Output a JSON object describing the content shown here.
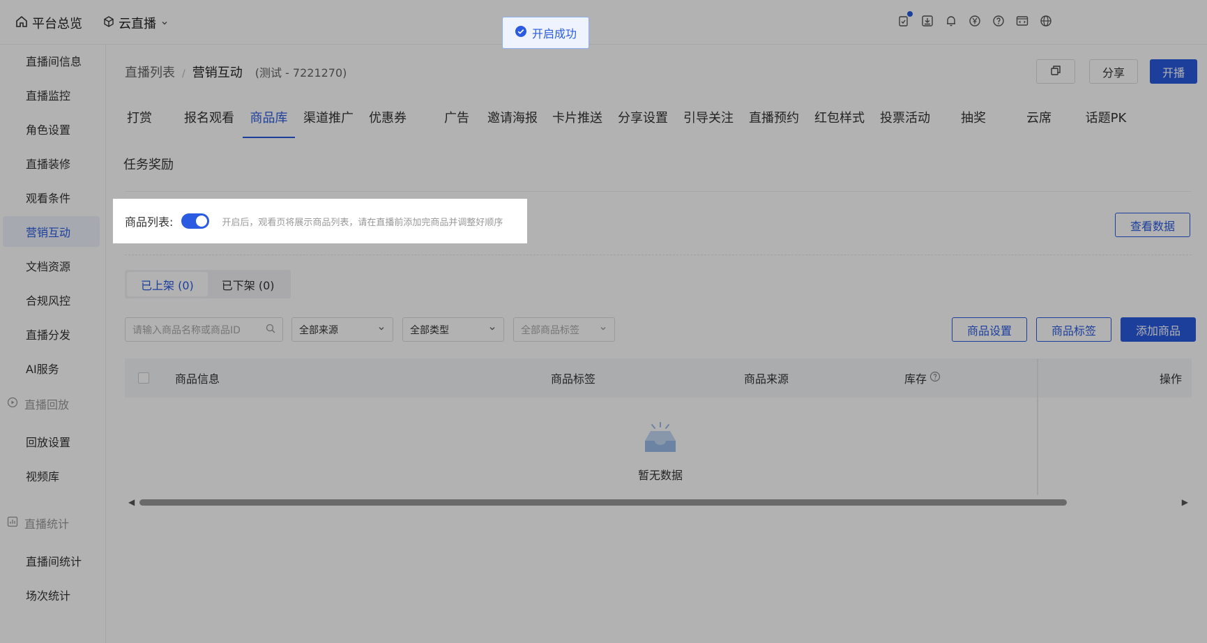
{
  "topbar": {
    "brand": "平台总览",
    "product": "云直播",
    "icons": [
      "task-icon",
      "download-icon",
      "bell-icon",
      "yuan-icon",
      "help-icon",
      "code-icon",
      "globe-icon"
    ]
  },
  "sidebar": {
    "items": [
      {
        "label": "直播间信息"
      },
      {
        "label": "直播监控"
      },
      {
        "label": "角色设置"
      },
      {
        "label": "直播装修"
      },
      {
        "label": "观看条件"
      },
      {
        "label": "营销互动"
      },
      {
        "label": "文档资源"
      },
      {
        "label": "合规风控"
      },
      {
        "label": "直播分发"
      },
      {
        "label": "AI服务"
      }
    ],
    "group_replay": "直播回放",
    "replay_items": [
      {
        "label": "回放设置"
      },
      {
        "label": "视频库"
      }
    ],
    "group_stats": "直播统计",
    "stats_items": [
      {
        "label": "直播间统计"
      },
      {
        "label": "场次统计"
      }
    ]
  },
  "breadcrumb": {
    "root": "直播列表",
    "separator": "/",
    "current": "营销互动",
    "room": "(测试 - 7221270)"
  },
  "header_buttons": {
    "share": "分享",
    "start": "开播"
  },
  "tabs": [
    {
      "label": "打赏"
    },
    {
      "label": "报名观看"
    },
    {
      "label": "商品库"
    },
    {
      "label": "渠道推广"
    },
    {
      "label": "优惠券"
    },
    {
      "label": "广告"
    },
    {
      "label": "邀请海报"
    },
    {
      "label": "卡片推送"
    },
    {
      "label": "分享设置"
    },
    {
      "label": "引导关注"
    },
    {
      "label": "直播预约"
    },
    {
      "label": "红包样式"
    },
    {
      "label": "投票活动"
    },
    {
      "label": "抽奖"
    },
    {
      "label": "云席"
    },
    {
      "label": "话题PK"
    },
    {
      "label": "任务奖励"
    }
  ],
  "active_tab": "商品库",
  "product_list_toggle": {
    "label": "商品列表:",
    "enabled": true,
    "hint": "开启后，观看页将展示商品列表，请在直播前添加完商品并调整好顺序"
  },
  "view_data_button": "查看数据",
  "segments": [
    {
      "label": "已上架 (0)"
    },
    {
      "label": "已下架 (0)"
    }
  ],
  "filters": {
    "search_placeholder": "请输入商品名称或商品ID",
    "source": "全部来源",
    "type": "全部类型",
    "tag_placeholder": "全部商品标签"
  },
  "action_buttons": {
    "settings": "商品设置",
    "tags": "商品标签",
    "add": "添加商品"
  },
  "table": {
    "columns": [
      "商品信息",
      "商品标签",
      "商品来源",
      "库存",
      "操作"
    ],
    "empty_text": "暂无数据"
  },
  "toast": {
    "text": "开启成功"
  },
  "colors": {
    "primary": "#2a5be0",
    "overlay": "rgba(0,0,0,0.30)"
  }
}
